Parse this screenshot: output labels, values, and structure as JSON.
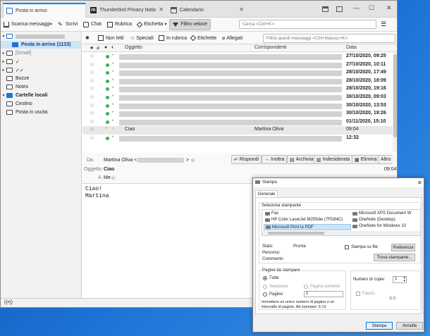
{
  "tabs": [
    {
      "label": "Posta in arrivo",
      "active": true
    },
    {
      "label": "Thunderbird Privacy Notic",
      "active": false
    },
    {
      "label": "Calendario",
      "active": false
    }
  ],
  "toolbar": {
    "get_messages": "Scarica messaggi",
    "write": "Scrivi",
    "chat": "Chat",
    "address_book": "Rubrica",
    "tag": "Etichetta",
    "quick_filter": "Filtro veloce",
    "search_placeholder": "Cerca <Ctrl+K>"
  },
  "quick_filter": {
    "unread": "Non letti",
    "starred": "Speciali",
    "contacts": "In rubrica",
    "tags": "Etichette",
    "attachments": "Allegati",
    "filter_placeholder": "Filtra questi messaggi <Ctrl+Maiusc+K>"
  },
  "folders": {
    "inbox": "Posta in arrivo (1133)",
    "gmail": "[Gmail]",
    "check1": "✓",
    "check2": "✓✓",
    "drafts": "Bozze",
    "notes": "Notes",
    "local": "Cartelle locali",
    "trash": "Cestino",
    "outbox": "Posta in uscita"
  },
  "columns": {
    "subject": "Oggetto",
    "correspondents": "Corrispondenti",
    "date": "Data"
  },
  "messages": [
    {
      "date": "27/10/2020, 09:25"
    },
    {
      "date": "27/10/2020, 10:11"
    },
    {
      "date": "28/10/2020, 17:49"
    },
    {
      "date": "28/10/2020, 18:09"
    },
    {
      "date": "28/10/2020, 19:16"
    },
    {
      "date": "30/10/2020, 09:03"
    },
    {
      "date": "30/10/2020, 13:53"
    },
    {
      "date": "30/10/2020, 19:26"
    },
    {
      "date": "01/11/2020, 15:10"
    },
    {
      "date": "09:04",
      "subject": "Ciao",
      "correspondent": "Martina Oliva",
      "selected": true
    },
    {
      "date": "12:32"
    }
  ],
  "message": {
    "from_label": "Da",
    "from_name": "Martina Oliva <",
    "from_end": ">",
    "subject_label": "Oggetto",
    "subject": "Ciao",
    "to_label": "A",
    "to": "Me",
    "time": "09:04",
    "body_lines": [
      "Ciao!",
      "Martina"
    ]
  },
  "actions": {
    "reply": "Rispondi",
    "forward": "Inoltra",
    "archive": "Archivia",
    "junk": "Indesiderata",
    "delete": "Elimina",
    "other": "Altro"
  },
  "print_dialog": {
    "title": "Stampa",
    "tab": "Generale",
    "select_printer": "Seleziona stampante",
    "printers": [
      "Fax",
      "HP Color LaserJet M255dw (7FD84C)",
      "Microsoft Print to PDF",
      "Microsoft XPS Document W",
      "OneNote (Desktop)",
      "OneNote for Windows 10"
    ],
    "status_label": "Stato:",
    "status_value": "Pronta",
    "location_label": "Percorso:",
    "comment_label": "Commento:",
    "print_to_file": "Stampa su file",
    "preferences": "Preferenze",
    "find_printer": "Trova stampante...",
    "page_range": "Pagine da stampare",
    "all": "Tutte",
    "selection": "Selezione",
    "current_page": "Pagina corrente",
    "pages": "Pagine:",
    "pages_value": "1",
    "hint": "Immettere un unico numero di pagina o un intervallo di pagine. Ad esempio: 5-12",
    "copies_label": "Numero di copie:",
    "copies_value": "1",
    "collate": "Fascic.",
    "print_button": "Stampa",
    "cancel_button": "Annulla"
  },
  "colors": {
    "accent": "#0a84ff",
    "selection": "#cfe3f7",
    "unread_dot": "#3bb24a"
  }
}
